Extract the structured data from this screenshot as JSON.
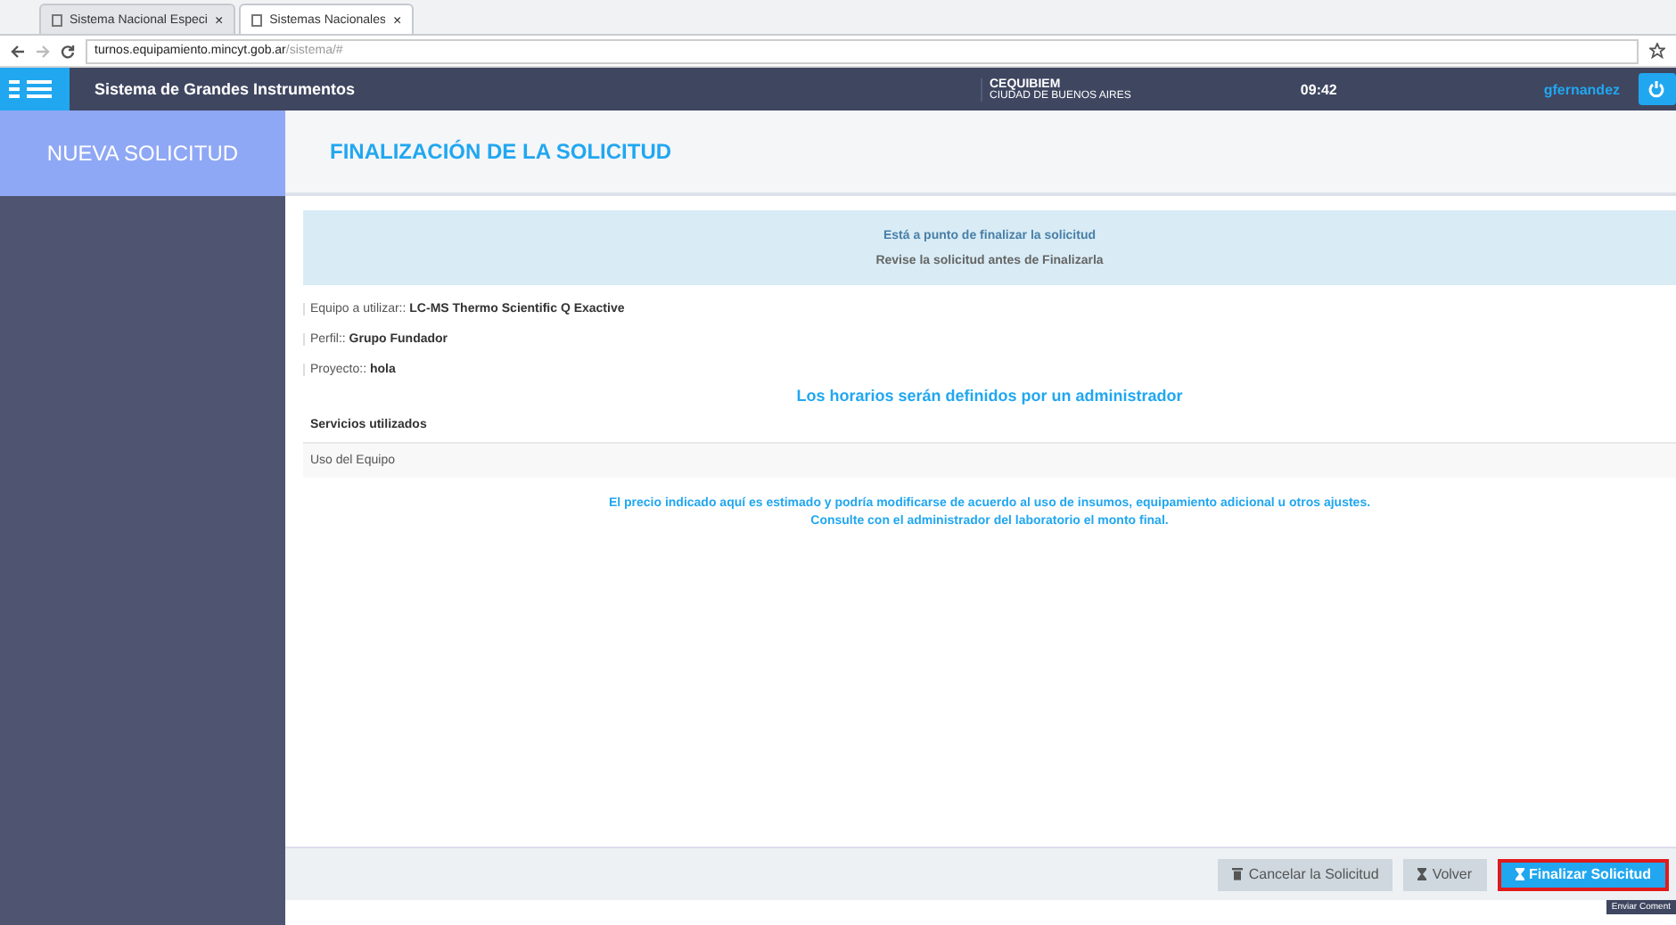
{
  "browser": {
    "tabs": [
      {
        "label": "Sistema Nacional Especi",
        "selected": false
      },
      {
        "label": "Sistemas Nacionales",
        "selected": true
      }
    ],
    "close": "×",
    "url_host": "turnos.equipamiento.mincyt.gob.ar",
    "url_path": "/sistema/#"
  },
  "header": {
    "app_title": "Sistema de Grandes Instrumentos",
    "center_name": "CEQUIBIEM",
    "center_city": "CIUDAD DE BUENOS AIRES",
    "time": "09:42",
    "user": "gfernandez"
  },
  "sidebar": {
    "title": "NUEVA SOLICITUD"
  },
  "page": {
    "title": "FINALIZACIÓN DE LA SOLICITUD",
    "alert": [
      "Está a punto de finalizar la solicitud",
      "Revise la solicitud antes de Finalizarla"
    ],
    "fields": [
      {
        "label": "Equipo a utilizar::",
        "value": "LC-MS Thermo Scientific Q Exactive"
      },
      {
        "label": "Perfil::",
        "value": "Grupo Fundador"
      },
      {
        "label": "Proyecto::",
        "value": "hola"
      }
    ],
    "schedule_note": "Los horarios serán definidos por un administrador",
    "services_heading": "Servicios utilizados",
    "services": [
      "Uso del Equipo"
    ],
    "price_note": [
      "El precio indicado aquí es estimado y podría modificarse de acuerdo al uso de insumos, equipamiento adicional u otros ajustes.",
      "Consulte con el administrador del laboratorio el monto final."
    ]
  },
  "footer": {
    "buttons": [
      {
        "kind": "cancel",
        "label": "Cancelar la Solicitud",
        "highlighted": false
      },
      {
        "kind": "back",
        "label": "Volver",
        "highlighted": false
      },
      {
        "kind": "finish",
        "label": "Finalizar Solicitud",
        "highlighted": true
      }
    ],
    "tooltip": "Enviar Coment"
  }
}
